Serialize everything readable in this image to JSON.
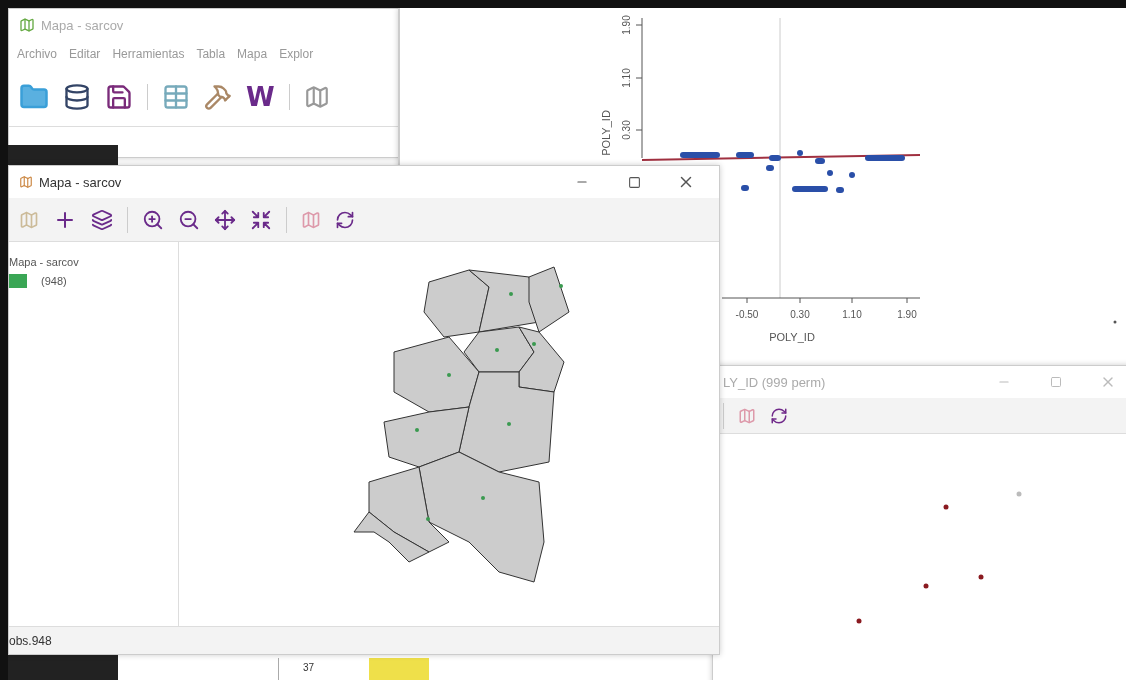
{
  "main_window": {
    "title": "Mapa - sarcov",
    "menu": [
      "Archivo",
      "Editar",
      "Herramientas",
      "Tabla",
      "Mapa",
      "Explor"
    ],
    "toolbar_letter": "W"
  },
  "scatter": {
    "y_label": "POLY_ID",
    "y_ticks": [
      "1.90",
      "1.10",
      "0.30"
    ],
    "x_label": "POLY_ID",
    "x_ticks": [
      "-0.50",
      "0.30",
      "1.10",
      "1.90"
    ]
  },
  "map_window": {
    "title": "Mapa - sarcov",
    "legend_title": "Mapa - sarcov",
    "legend": [
      {
        "label": "(948)",
        "color": "#3aa655"
      }
    ],
    "status": "obs.948"
  },
  "perm_window": {
    "title": "LY_ID (999 perm)"
  },
  "table": {
    "row_label": "37"
  }
}
